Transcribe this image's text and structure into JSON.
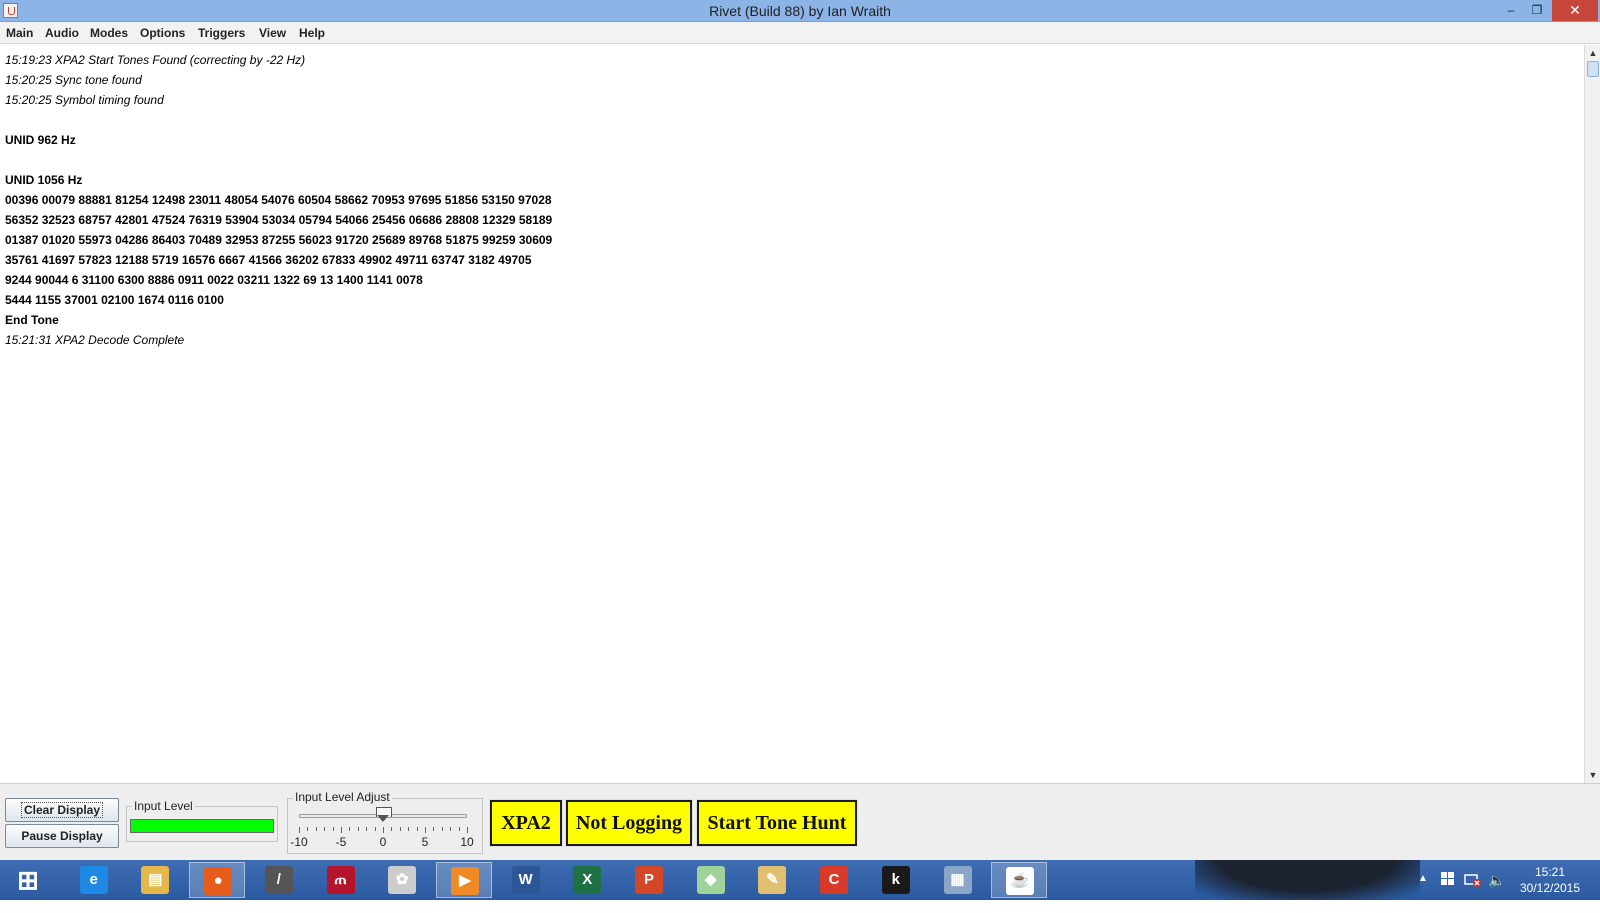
{
  "window": {
    "title": "Rivet (Build 88) by Ian Wraith",
    "minimize_glyph": "–",
    "maximize_glyph": "❐",
    "close_glyph": "✕"
  },
  "menu": [
    "Main",
    "Audio",
    "Modes",
    "Options",
    "Triggers",
    "View",
    "Help"
  ],
  "log": [
    {
      "text": "15:19:23 XPA2 Start Tones Found (correcting by -22 Hz)",
      "style": "italic"
    },
    {
      "text": "15:20:25 Sync tone found",
      "style": "italic"
    },
    {
      "text": "15:20:25 Symbol timing found",
      "style": "italic"
    },
    {
      "text": "",
      "style": "blank"
    },
    {
      "text": "UNID 962 Hz",
      "style": "bold"
    },
    {
      "text": "",
      "style": "blank"
    },
    {
      "text": "UNID 1056 Hz",
      "style": "bold"
    },
    {
      "text": "00396 00079 88881 81254 12498 23011 48054 54076 60504 58662 70953 97695 51856 53150 97028",
      "style": "bold"
    },
    {
      "text": "56352 32523 68757 42801 47524 76319 53904 53034 05794 54066 25456 06686 28808 12329 58189",
      "style": "bold"
    },
    {
      "text": "01387 01020 55973 04286 86403 70489 32953 87255 56023 91720 25689 89768 51875 99259 30609",
      "style": "bold"
    },
    {
      "text": "35761 41697 57823 12188 5719 16576 6667 41566 36202 67833 49902 49711 63747 3182 49705",
      "style": "bold"
    },
    {
      "text": "9244 90044 6 31100 6300 8886 0911 0022 03211 1322 69 13 1400 1141 0078",
      "style": "bold"
    },
    {
      "text": "5444 1155 37001 02100 1674 0116 0100",
      "style": "bold"
    },
    {
      "text": "End Tone",
      "style": "bold"
    },
    {
      "text": "15:21:31 XPA2 Decode Complete",
      "style": "italic"
    }
  ],
  "scrollbar": {
    "up": "▲",
    "down": "▼"
  },
  "controls": {
    "clear_label": "Clear Display",
    "pause_label": "Pause Display",
    "input_level_label": "Input Level",
    "input_level_fraction": 1.0,
    "input_level_color": "#00ff00",
    "adjust_label": "Input Level Adjust",
    "adjust_min": -10,
    "adjust_max": 10,
    "adjust_value": 0,
    "adjust_ticks": [
      "-10",
      "-5",
      "0",
      "5",
      "10"
    ],
    "mode_label": "XPA2",
    "logging_label": "Not Logging",
    "hunt_label": "Start Tone Hunt",
    "button_color": "#ffff00"
  },
  "taskbar": {
    "apps": [
      {
        "name": "start-icon",
        "glyph": "⊞",
        "color": "transparent",
        "active": false
      },
      {
        "name": "internet-explorer-icon",
        "glyph": "e",
        "color": "#1e88e5",
        "active": false
      },
      {
        "name": "file-explorer-icon",
        "glyph": "▤",
        "color": "#e6b84a",
        "active": false
      },
      {
        "name": "firefox-icon",
        "glyph": "●",
        "color": "#e65c1a",
        "active": true
      },
      {
        "name": "microphone-icon",
        "glyph": "/",
        "color": "#555555",
        "active": false
      },
      {
        "name": "mendeley-icon",
        "glyph": "ጠ",
        "color": "#b3132b",
        "active": false
      },
      {
        "name": "sheep-icon",
        "glyph": "✿",
        "color": "#cccccc",
        "active": false
      },
      {
        "name": "media-player-icon",
        "glyph": "▶",
        "color": "#f08a24",
        "active": true
      },
      {
        "name": "word-icon",
        "glyph": "W",
        "color": "#2b5797",
        "active": false
      },
      {
        "name": "excel-icon",
        "glyph": "X",
        "color": "#1e7145",
        "active": false
      },
      {
        "name": "powerpoint-icon",
        "glyph": "P",
        "color": "#d24726",
        "active": false
      },
      {
        "name": "folder-icon",
        "glyph": "◆",
        "color": "#9fd39b",
        "active": false
      },
      {
        "name": "paint-icon",
        "glyph": "✎",
        "color": "#e0c070",
        "active": false
      },
      {
        "name": "ccleaner-icon",
        "glyph": "C",
        "color": "#d83a2a",
        "active": false
      },
      {
        "name": "kindle-icon",
        "glyph": "k",
        "color": "#1a1a1a",
        "active": false
      },
      {
        "name": "calculator-icon",
        "glyph": "▦",
        "color": "#8aa7c8",
        "active": false
      },
      {
        "name": "java-icon",
        "glyph": "☕",
        "color": "#ffffff",
        "active": true
      }
    ],
    "tray_up": "▲",
    "tray_volume": "🔈",
    "clock_time": "15:21",
    "clock_date": "30/12/2015"
  }
}
